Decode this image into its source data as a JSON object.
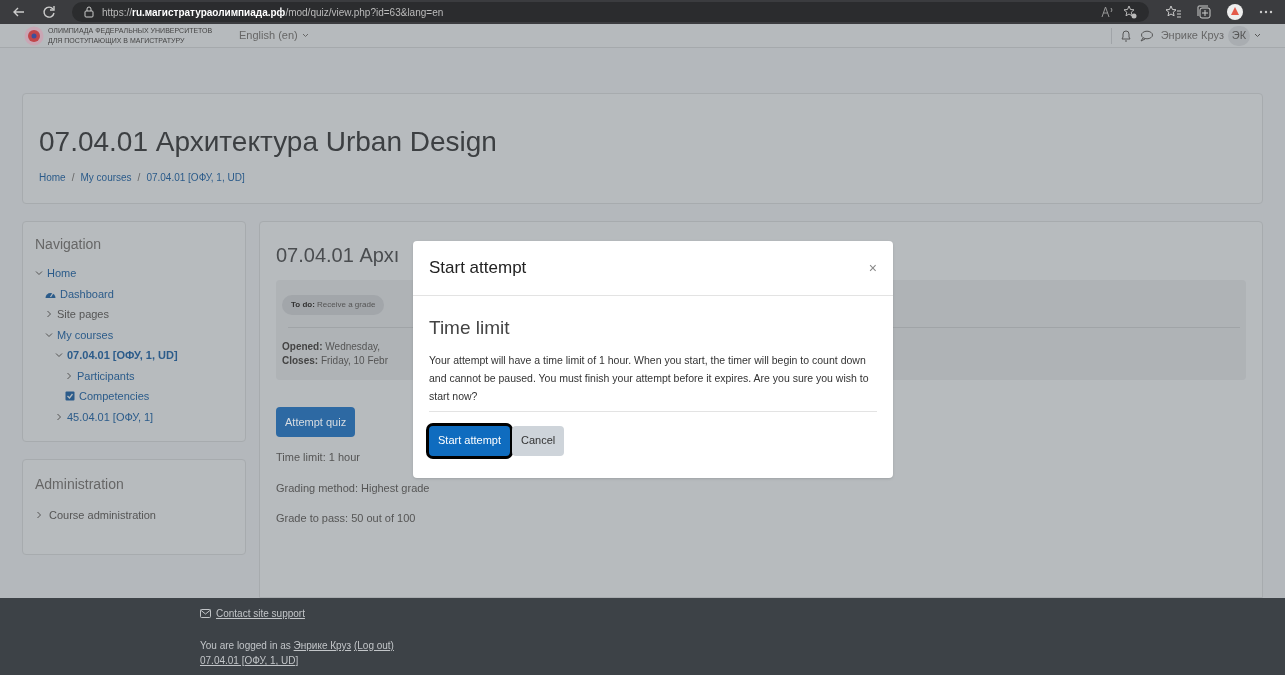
{
  "browser": {
    "url_prefix": "https://",
    "url_host": "ru.магистратураолимпиада.рф",
    "url_path": "/mod/quiz/view.php?id=63&lang=en"
  },
  "navbar": {
    "logo_text": [
      "ОЛИМПИАДА ФЕДЕРАЛЬНЫХ УНИВЕРСИТЕТОВ",
      "ДЛЯ ПОСТУПАЮЩИХ В МАГИСТРАТУРУ"
    ],
    "language": "English (en)",
    "user_name": "Энрике Круз",
    "user_initials": "ЭК"
  },
  "page_header": {
    "title": "07.04.01 Архитектура Urban Design",
    "breadcrumbs": [
      "Home",
      "My courses",
      "07.04.01 [ОФУ, 1, UD]"
    ],
    "separator": "/"
  },
  "navigation": {
    "title": "Navigation",
    "items": [
      {
        "label": "Home",
        "kind": "toggle",
        "expanded": true,
        "bold": false,
        "children": [
          {
            "label": "Dashboard",
            "kind": "dashboard",
            "bold": false
          },
          {
            "label": "Site pages",
            "kind": "plain",
            "expanded": false,
            "bold": false
          },
          {
            "label": "My courses",
            "kind": "toggle",
            "expanded": true,
            "bold": false,
            "children": [
              {
                "label": "07.04.01 [ОФУ, 1, UD]",
                "kind": "toggle",
                "expanded": true,
                "bold": true,
                "children": [
                  {
                    "label": "Participants",
                    "kind": "toggle",
                    "expanded": false,
                    "bold": false
                  },
                  {
                    "label": "Competencies",
                    "kind": "competency",
                    "bold": false
                  }
                ]
              },
              {
                "label": "45.04.01 [ОФУ, 1]",
                "kind": "toggle",
                "expanded": false,
                "bold": false
              }
            ]
          }
        ]
      }
    ]
  },
  "administration": {
    "title": "Administration",
    "items": [
      {
        "label": "Course administration",
        "expanded": false
      }
    ]
  },
  "quiz": {
    "title": "07.04.01 Архı",
    "todo_label": "To do:",
    "todo_text": "Receive a grade",
    "opened_label": "Opened:",
    "opened_value": "Wednesday,",
    "closes_label": "Closes:",
    "closes_value": "Friday, 10 Febr",
    "attempt_button": "Attempt quiz",
    "info": [
      "Time limit: 1 hour",
      "Grading method: Highest grade",
      "Grade to pass: 50 out of 100"
    ]
  },
  "modal": {
    "title": "Start attempt",
    "close": "×",
    "heading": "Time limit",
    "text": "Your attempt will have a time limit of 1 hour. When you start, the timer will begin to count down and cannot be paused. You must finish your attempt before it expires. Are you sure you wish to start now?",
    "buttons": [
      {
        "label": "Start attempt",
        "kind": "primary",
        "focused": true
      },
      {
        "label": "Cancel",
        "kind": "secondary",
        "focused": false
      }
    ]
  },
  "footer": {
    "contact": "Contact site support",
    "logged_in_prefix": "You are logged in as",
    "user_link": "Энрике Круз",
    "logout_link": "(Log out)",
    "course_link": "07.04.01 [ОФУ, 1, UD]"
  }
}
